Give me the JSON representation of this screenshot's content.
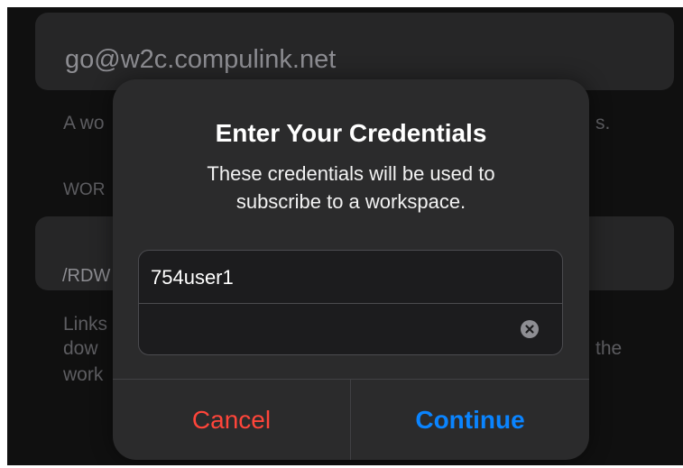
{
  "background": {
    "email_value": "go@w2c.compulink.net",
    "frag_help_left": "A wo",
    "frag_help_right": "s.",
    "section_label_frag": "WOR",
    "url_value_frag": "/RDW",
    "links_frag_1": "Links",
    "links_frag_2": "dow",
    "links_frag_3": "work",
    "links_frag_right": "the"
  },
  "dialog": {
    "title": "Enter Your Credentials",
    "message_line1": "These credentials will be used to",
    "message_line2": "subscribe to a workspace.",
    "username_value": "754user1",
    "password_value": "",
    "clear_icon": "clear-circle-icon",
    "cancel_label": "Cancel",
    "continue_label": "Continue"
  },
  "colors": {
    "cancel": "#ff453a",
    "continue": "#0a84ff"
  }
}
